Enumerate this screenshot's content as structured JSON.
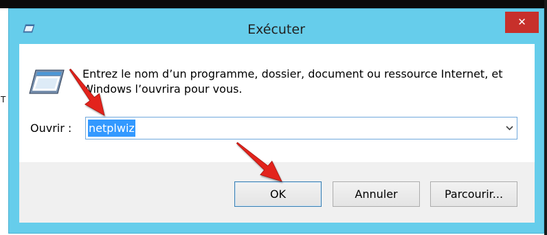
{
  "window": {
    "title": "Exécuter",
    "title_icon": "run-icon",
    "close_button": {
      "icon": "close-icon",
      "glyph": "✕"
    }
  },
  "content": {
    "icon": "run-icon",
    "description_lines": [
      "Entrez le nom d’un programme, dossier, document ou ressource Internet, et",
      "Windows l’ouvrira pour vous."
    ],
    "open_label": "Ouvrir :",
    "open_input": {
      "value": "netplwiz",
      "value_selected": true,
      "dropdown_icon": "chevron-down-icon"
    }
  },
  "buttons": {
    "ok": "OK",
    "cancel": "Annuler",
    "browse": "Parcourir...",
    "default": "ok"
  },
  "background": {
    "edge_text": "T"
  },
  "colors": {
    "frame": "#66CDEB",
    "close_button": "#C7302B",
    "selection": "#3399FF",
    "default_button_border": "#3C7FB1",
    "annotation_arrow": "#E3231C"
  }
}
